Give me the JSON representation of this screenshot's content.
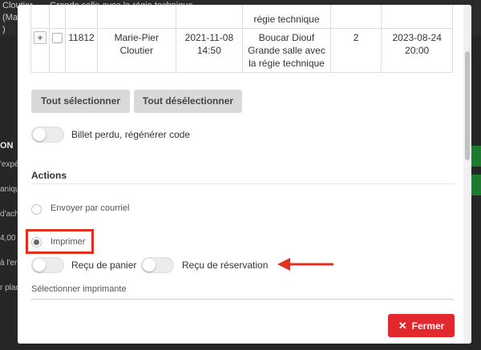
{
  "background": {
    "top_left_lines": [
      "Cloutier",
      "(Ma",
      ")"
    ],
    "top_right_text": "Grande salle avec la régie technique",
    "side_fragments": [
      "ON",
      "'expé",
      "aniqu",
      "d'ach",
      "4,00",
      "à l'er",
      "r plac"
    ]
  },
  "table": {
    "partial_row": {
      "location_tail": "régie technique"
    },
    "row": {
      "plus_label": "+",
      "id": "11812",
      "name": "Marie-Pier Cloutier",
      "date": "2021-11-08 14:50",
      "location": "Boucar Diouf Grande salle avec la régie technique",
      "quantity": "2",
      "event_date": "2023-08-24 20:00"
    }
  },
  "buttons": {
    "select_all": "Tout sélectionner",
    "deselect_all": "Tout désélectionner",
    "close": "Fermer",
    "close_icon": "✕"
  },
  "lost_ticket_label": "Billet perdu, régénérer code",
  "actions": {
    "title": "Actions",
    "email_label": "Envoyer par courriel",
    "print_label": "Imprimer",
    "cart_receipt_label": "Reçu de panier",
    "reservation_receipt_label": "Reçu de réservation",
    "printer_label": "Sélectionner imprimante"
  },
  "colors": {
    "close_button": "#e0282e",
    "annotation": "#e03020",
    "toggle_off": "#ececec"
  }
}
